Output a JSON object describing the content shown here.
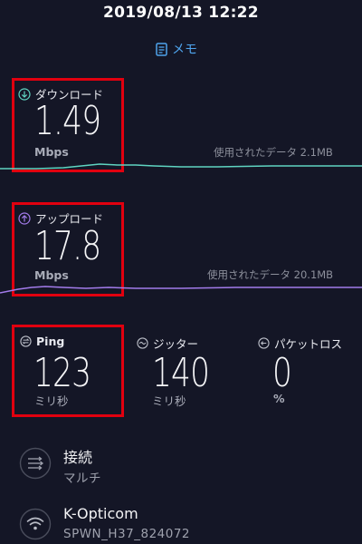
{
  "status": {
    "datetime": "2019/08/13 12:22"
  },
  "memo": {
    "label": "メモ"
  },
  "download": {
    "label": "ダウンロード",
    "value": "1.49",
    "unit": "Mbps",
    "data_used": "使用されたデータ 2.1MB",
    "color": "#5fd4c1"
  },
  "upload": {
    "label": "アップロード",
    "value": "17.8",
    "unit": "Mbps",
    "data_used": "使用されたデータ 20.1MB",
    "color": "#a27bea"
  },
  "ping": {
    "label": "Ping",
    "value": "123",
    "unit": "ミリ秒"
  },
  "jitter": {
    "label": "ジッター",
    "value": "140",
    "unit": "ミリ秒"
  },
  "packet_loss": {
    "label": "パケットロス",
    "value": "0",
    "unit": "%"
  },
  "connection": {
    "title": "接続",
    "subtitle": "マルチ"
  },
  "network": {
    "title": "K-Opticom",
    "subtitle": "SPWN_H37_824072"
  },
  "colors": {
    "accent_blue": "#4ea3ec",
    "highlight_red": "#e1000f",
    "background": "#141626"
  }
}
